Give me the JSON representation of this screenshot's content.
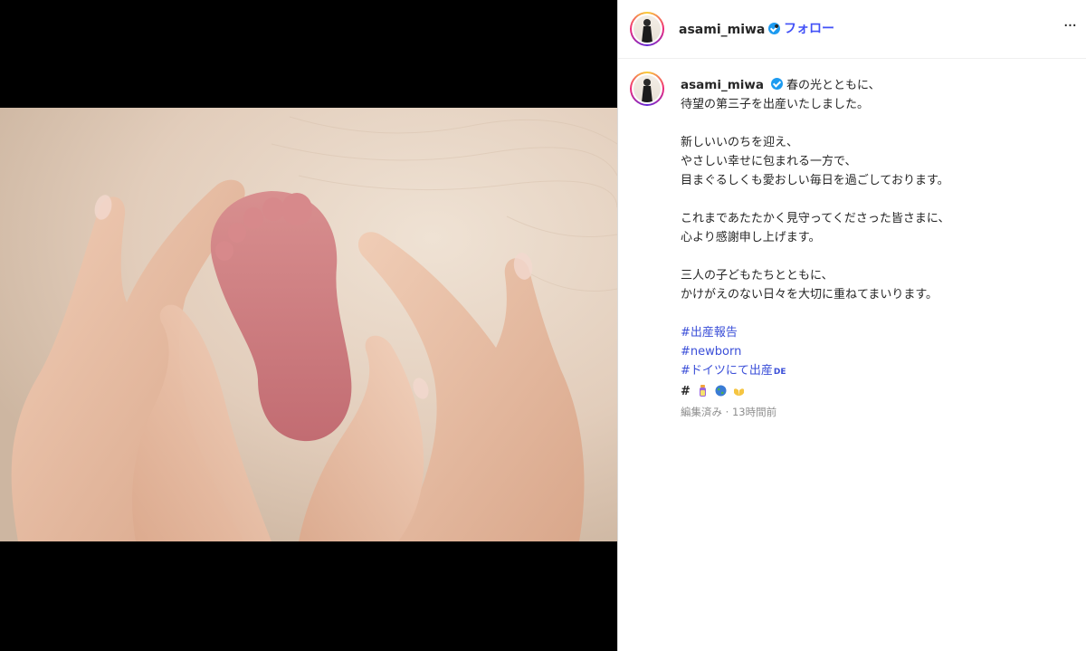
{
  "post": {
    "username": "asami_miwa",
    "dot_separator": "•",
    "follow_label": "フォロー",
    "more_label": "···",
    "caption": {
      "paragraphs": [
        [
          "春の光とともに、",
          "待望の第三子を出産いたしました。"
        ],
        [
          "新しいいのちを迎え、",
          "やさしい幸せに包まれる一方で、",
          "目まぐるしくも愛おしい毎日を過ごしております。"
        ],
        [
          "これまであたたかく見守ってくださった皆さまに、",
          "心より感謝申し上げます。"
        ],
        [
          "三人の子どもたちとともに、",
          "かけがえのない日々を大切に重ねてまいります。"
        ]
      ],
      "hashtags": [
        "#出産報告",
        "#newborn",
        "#ドイツにて出産"
      ],
      "de_badge": "DE",
      "emoji_hash": "#",
      "emoji_icons": [
        "baby-bottle-icon",
        "globe-icon",
        "open-hands-icon"
      ]
    },
    "meta": "編集済み · 13時間前"
  },
  "colors": {
    "follow": "#4150f7",
    "hashtag": "#3b4fd8",
    "verified": "#1d9bf0",
    "meta": "#8e8e8e"
  },
  "media": {
    "description_icon": "baby-foot-in-hands-photo",
    "carousel_position": 1
  }
}
